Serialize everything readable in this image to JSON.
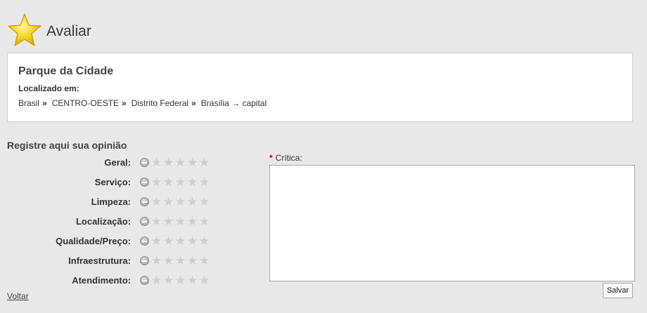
{
  "header": {
    "title": "Avaliar",
    "icon": "star-icon"
  },
  "place": {
    "name": "Parque da Cidade",
    "located_label": "Localizado em:",
    "breadcrumb": [
      "Brasil",
      "CENTRO-OESTE",
      "Distrito Federal",
      "Brasília → capital"
    ],
    "separator": "»"
  },
  "opinion": {
    "title": "Registre aqui sua opinião",
    "max_stars": 5,
    "criteria": [
      {
        "label": "Geral:",
        "rating": 0
      },
      {
        "label": "Serviço:",
        "rating": 0
      },
      {
        "label": "Limpeza:",
        "rating": 0
      },
      {
        "label": "Localização:",
        "rating": 0
      },
      {
        "label": "Qualidade/Preço:",
        "rating": 0
      },
      {
        "label": "Infraestrutura:",
        "rating": 0
      },
      {
        "label": "Atendimento:",
        "rating": 0
      }
    ]
  },
  "review": {
    "required_marker": "*",
    "label": "Crítica:",
    "value": ""
  },
  "actions": {
    "save_label": "Salvar",
    "back_label": "Voltar"
  },
  "colors": {
    "background": "#e8e8e8",
    "star_empty": "#cfcfcf",
    "required": "#cc0000"
  }
}
